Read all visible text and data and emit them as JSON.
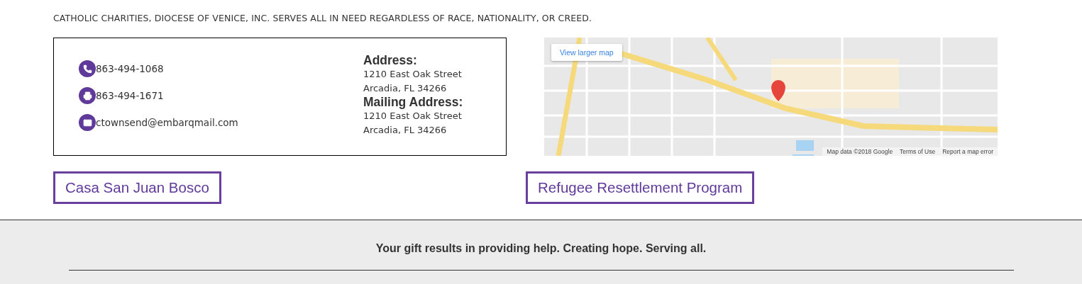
{
  "notice": "CATHOLIC CHARITIES, DIOCESE OF VENICE, INC. SERVES ALL IN NEED REGARDLESS OF RACE, NATIONALITY, OR CREED.",
  "contacts": [
    {
      "kind": "phone",
      "text": "863-494-1068"
    },
    {
      "kind": "fax",
      "text": "863-494-1671"
    },
    {
      "kind": "email",
      "text": "ctownsend@embarqmail.com"
    }
  ],
  "addresses": [
    {
      "heading": "Address:",
      "lines": [
        "1210 East Oak Street",
        "Arcadia, FL 34266"
      ]
    },
    {
      "heading": "Mailing Address:",
      "lines": [
        "1210 East Oak Street",
        "Arcadia, FL 34266"
      ]
    }
  ],
  "map": {
    "kind": "picture",
    "button": "View larger map",
    "attribution": [
      "Map data ©2018 Google",
      "Terms of Use",
      "Report a map error"
    ]
  },
  "links": [
    "Casa San Juan Bosco",
    "Refugee Resettlement Program"
  ],
  "footer": {
    "tagline": "Your gift results in providing help. Creating hope. Serving all."
  }
}
